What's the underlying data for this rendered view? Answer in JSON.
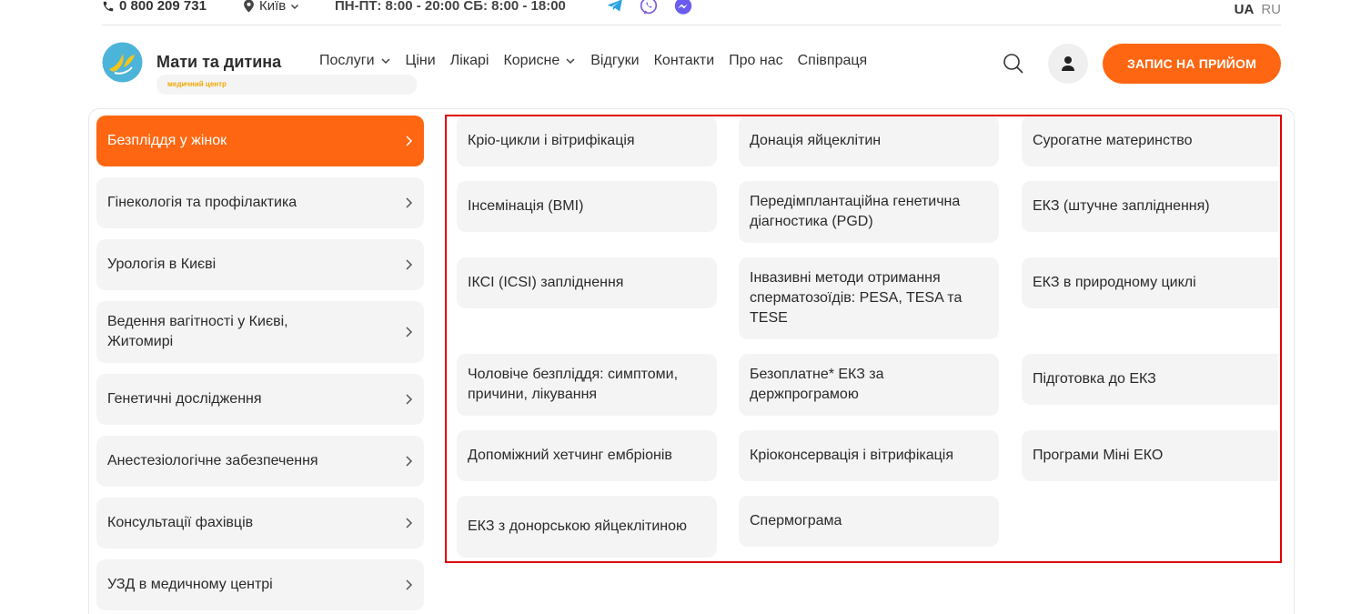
{
  "topbar": {
    "phone": "0 800 209 731",
    "city": "Київ",
    "hours": "ПН-ПТ: 8:00 - 20:00  СБ: 8:00 - 18:00",
    "lang_active": "UA",
    "lang_other": "RU"
  },
  "header": {
    "logo_name": "Мати та дитина",
    "logo_sub": "медичний центр",
    "nav": [
      "Послуги",
      "Ціни",
      "Лікарі",
      "Корисне",
      "Відгуки",
      "Контакти",
      "Про нас",
      "Співпраця"
    ],
    "cta": "ЗАПИС НА ПРИЙОМ"
  },
  "categories": [
    "Безпліддя у жінок",
    "Гінекологія та профілактика",
    "Урологія в Києві",
    "Ведення вагітності у Києві, Житомирі",
    "Генетичні дослідження",
    "Анестезіологічне забезпечення",
    "Консультації фахівців",
    "УЗД в медичному центрі"
  ],
  "subitems": [
    "Кріо-цикли і вітрифікація",
    "Донація яйцеклітин",
    "Сурогатне материнство",
    "Інсемінація (ВМІ)",
    "Передімплантаційна генетична діагностика (PGD)",
    "ЕКЗ (штучне запліднення)",
    "ІКСІ (ICSI) запліднення",
    "Інвазивні методи отримання сперматозоїдів: PESA, TESA та TESE",
    "ЕКЗ в природному циклі",
    "Чоловіче безпліддя: симптоми, причини, лікування",
    "Безоплатне* ЕКЗ за держпрограмою",
    "Підготовка до ЕКЗ",
    "Допоміжний хетчинг ембріонів",
    "Кріоконсервація і вітрифікація",
    "Програми Міні ЕКО",
    "ЕКЗ з донорською яйцеклітиною",
    "Спермограма"
  ],
  "colors": {
    "accent": "#ff6611",
    "highlight_frame": "#e00000",
    "tile_bg": "#f4f4f4"
  },
  "icons": [
    "phone-icon",
    "location-pin-icon",
    "chevron-down-icon",
    "telegram-icon",
    "viber-icon",
    "messenger-icon",
    "search-icon",
    "user-icon",
    "chevron-right-icon"
  ]
}
